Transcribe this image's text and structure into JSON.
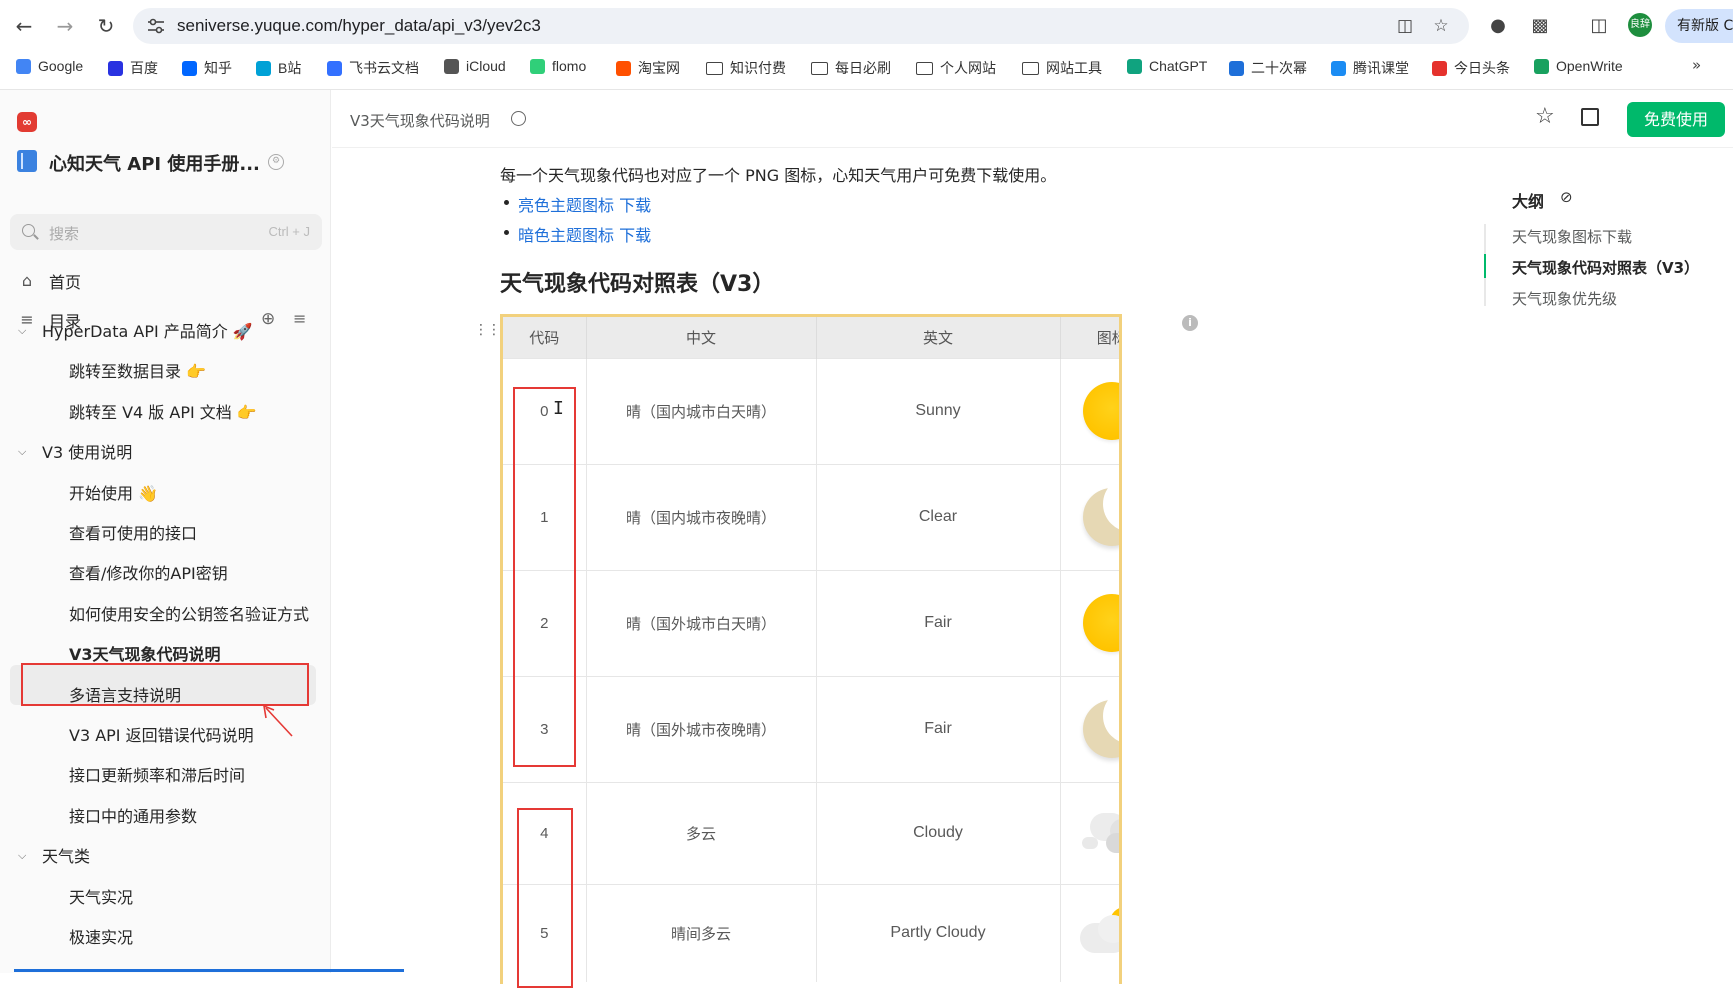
{
  "browser": {
    "url": "seniverse.yuque.com/hyper_data/api_v3/yev2c3",
    "avatar_label": "良辞",
    "new_version_label": "有新版 C",
    "bookmarks": [
      {
        "label": "Google",
        "icon": "google-icon",
        "color": "#4285f4"
      },
      {
        "label": "百度",
        "icon": "baidu-icon",
        "color": "#2932e1"
      },
      {
        "label": "知乎",
        "icon": "zhihu-icon",
        "color": "#0066ff"
      },
      {
        "label": "B站",
        "icon": "bilibili-icon",
        "color": "#00a1d6"
      },
      {
        "label": "飞书云文档",
        "icon": "feishu-icon",
        "color": "#3370ff"
      },
      {
        "label": "iCloud",
        "icon": "apple-icon",
        "color": "#555555"
      },
      {
        "label": "flomo",
        "icon": "flomo-icon",
        "color": "#30cf79"
      },
      {
        "label": "淘宝网",
        "icon": "taobao-icon",
        "color": "#ff5000"
      },
      {
        "label": "知识付费",
        "icon": "folder-icon",
        "color": ""
      },
      {
        "label": "每日必刷",
        "icon": "folder-icon",
        "color": ""
      },
      {
        "label": "个人网站",
        "icon": "folder-icon",
        "color": ""
      },
      {
        "label": "网站工具",
        "icon": "folder-icon",
        "color": ""
      },
      {
        "label": "ChatGPT",
        "icon": "chatgpt-icon",
        "color": "#10a37f"
      },
      {
        "label": "二十次幂",
        "icon": "ershicimi-icon",
        "color": "#1e6fd9"
      },
      {
        "label": "腾讯课堂",
        "icon": "tencent-icon",
        "color": "#1b8cf3"
      },
      {
        "label": "今日头条",
        "icon": "toutiao-icon",
        "color": "#e5322d"
      },
      {
        "label": "OpenWrite",
        "icon": "openwrite-icon",
        "color": "#19a15f"
      }
    ]
  },
  "sidebar": {
    "book_title": "心知天气 API 使用手册...",
    "search_placeholder": "搜索",
    "search_shortcut": "Ctrl + J",
    "home_label": "首页",
    "toc_label": "目录",
    "groups": [
      {
        "label": "HyperData API 产品简介 🚀",
        "items": [
          "跳转至数据目录 👉",
          "跳转至 V4 版 API 文档 👉"
        ]
      },
      {
        "label": "V3 使用说明",
        "items": [
          "开始使用 👋",
          "查看可使用的接口",
          "查看/修改你的API密钥",
          "如何使用安全的公钥签名验证方式",
          "V3天气现象代码说明",
          "多语言支持说明",
          "V3 API 返回错误代码说明",
          "接口更新频率和滞后时间",
          "接口中的通用参数"
        ]
      },
      {
        "label": "天气类",
        "items": [
          "天气实况",
          "极速实况"
        ]
      }
    ]
  },
  "docbar": {
    "crumb": "V3天气现象代码说明",
    "free_button": "免费使用"
  },
  "content": {
    "intro": "每一个天气现象代码也对应了一个 PNG 图标，心知天气用户可免费下载使用。",
    "links": [
      {
        "text": "亮色主题图标 下载"
      },
      {
        "text": "暗色主题图标 下载"
      }
    ],
    "heading": "天气现象代码对照表（V3）",
    "table": {
      "headers": [
        "代码",
        "中文",
        "英文",
        "图标"
      ],
      "rows": [
        {
          "code": "0",
          "zh": "晴（国内城市白天晴）",
          "en": "Sunny",
          "icon": "sun-icon"
        },
        {
          "code": "1",
          "zh": "晴（国内城市夜晚晴）",
          "en": "Clear",
          "icon": "moon-icon"
        },
        {
          "code": "2",
          "zh": "晴（国外城市白天晴）",
          "en": "Fair",
          "icon": "sun-icon"
        },
        {
          "code": "3",
          "zh": "晴（国外城市夜晚晴）",
          "en": "Fair",
          "icon": "moon-icon"
        },
        {
          "code": "4",
          "zh": "多云",
          "en": "Cloudy",
          "icon": "cloud-icon"
        },
        {
          "code": "5",
          "zh": "晴间多云",
          "en": "Partly Cloudy",
          "icon": "partly-cloudy-icon"
        }
      ]
    }
  },
  "outline": {
    "title": "大纲",
    "items": [
      {
        "label": "天气现象图标下载",
        "active": false
      },
      {
        "label": "天气现象代码对照表（V3）",
        "active": true
      },
      {
        "label": "天气现象优先级",
        "active": false
      }
    ]
  },
  "colors": {
    "accent": "#00b96b",
    "link": "#1e6fd9",
    "highlight": "#e53935",
    "table_border": "#f2d17d"
  }
}
